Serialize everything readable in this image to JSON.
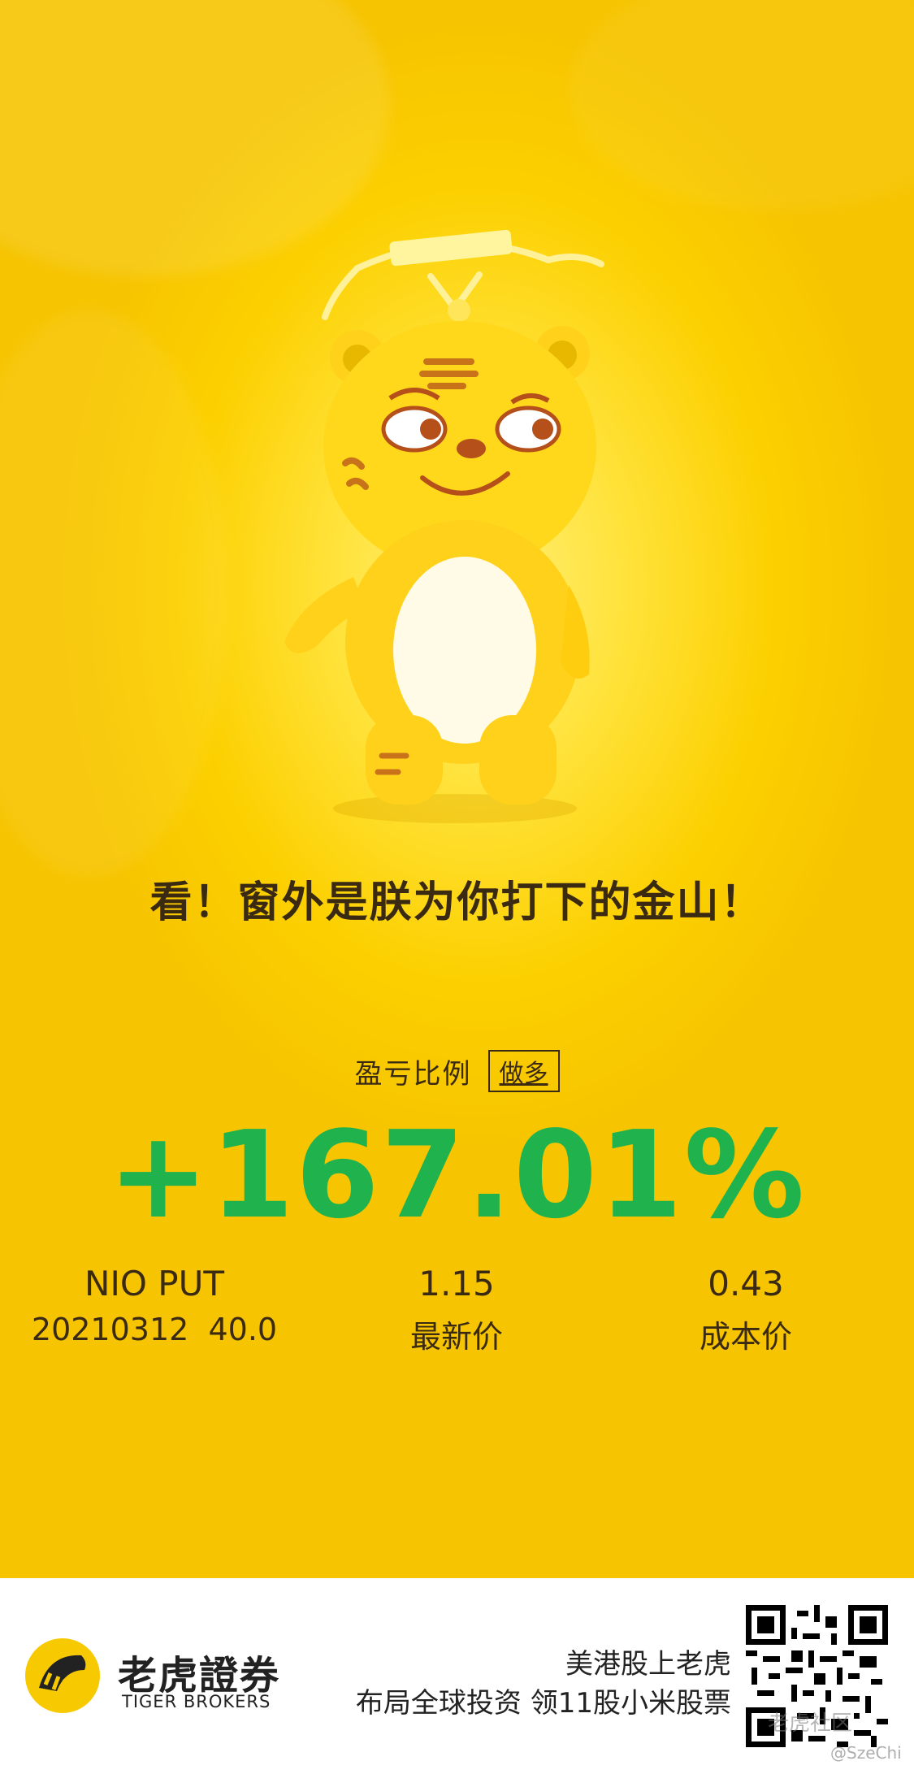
{
  "poster": {
    "headline": "看！窗外是朕为你打下的金山！",
    "pl_label": "盈亏比例",
    "pl_badge": "做多",
    "pl_value": "+167.01%",
    "accent_green": "#1fb24d",
    "background_yellow": "#f7c900"
  },
  "stats": {
    "contract_name": "NIO PUT",
    "contract_detail": "20210312  40.0",
    "latest_price": "1.15",
    "latest_price_label": "最新价",
    "cost_price": "0.43",
    "cost_price_label": "成本价"
  },
  "footer": {
    "brand_cn": "老虎證券",
    "brand_en": "TIGER BROKERS",
    "promo_line1": "美港股上老虎",
    "promo_line2": "布局全球投资 领11股小米股票",
    "qr_icon": "qr-code-icon",
    "watermark_community": "老虎社区",
    "watermark_user": "@SzeChi"
  }
}
